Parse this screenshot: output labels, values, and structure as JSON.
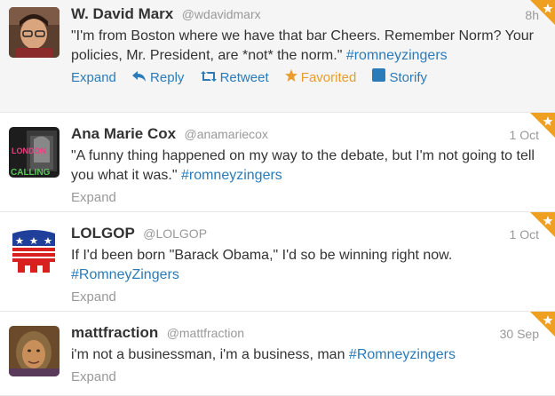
{
  "tweets": [
    {
      "name": "W. David Marx",
      "handle": "@wdavidmarx",
      "time": "8h",
      "text_before": "\"I'm from Boston where we have that bar Cheers. Remember Norm? Your policies, Mr. President, are *not* the norm.\"",
      "hashtag": "#romneyzingers",
      "actions": {
        "expand": "Expand",
        "reply": "Reply",
        "retweet": "Retweet",
        "favorited": "Favorited",
        "storify": "Storify"
      }
    },
    {
      "name": "Ana Marie Cox",
      "handle": "@anamariecox",
      "time": "1 Oct",
      "text_before": "\"A funny thing happened on my way to the debate, but I'm not going to tell you what it was.\"",
      "hashtag": "#romneyzingers",
      "expand": "Expand"
    },
    {
      "name": "LOLGOP",
      "handle": "@LOLGOP",
      "time": "1 Oct",
      "text_before": "If I'd been born \"Barack Obama,\" I'd so be winning right now.",
      "hashtag": "#RomneyZingers",
      "expand": "Expand"
    },
    {
      "name": "mattfraction",
      "handle": "@mattfraction",
      "time": "30 Sep",
      "text_before": "i'm not a businessman, i'm a business, man",
      "hashtag": "#Romneyzingers",
      "expand": "Expand"
    }
  ],
  "colors": {
    "link": "#2b7bb9",
    "favorite": "#e89d2d",
    "muted": "#999999",
    "text": "#333333",
    "corner": "#f0a020"
  }
}
